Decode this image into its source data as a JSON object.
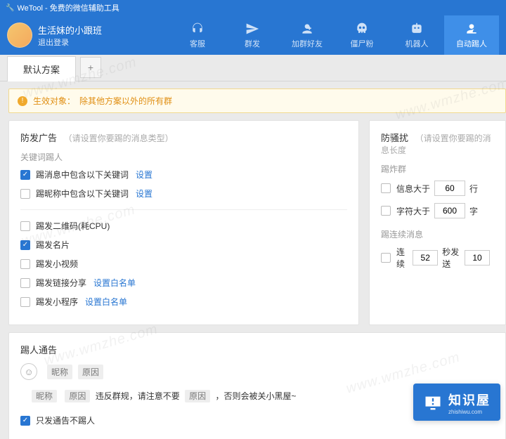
{
  "titlebar": {
    "text": "WeTool - 免费的微信辅助工具"
  },
  "user": {
    "name": "生活妹的小跟班",
    "logout": "退出登录"
  },
  "nav": [
    {
      "key": "cs",
      "label": "客服"
    },
    {
      "key": "mass",
      "label": "群发"
    },
    {
      "key": "add",
      "label": "加群好友"
    },
    {
      "key": "zombie",
      "label": "僵尸粉"
    },
    {
      "key": "robot",
      "label": "机器人"
    },
    {
      "key": "kick",
      "label": "自动踢人",
      "active": true
    }
  ],
  "tabs": {
    "active": "默认方案"
  },
  "notice": {
    "label": "生效对象：",
    "text": "除其他方案以外的所有群"
  },
  "antiAd": {
    "title": "防发广告",
    "hint": "（请设置你要踢的消息类型）",
    "keywordTitle": "关键词踢人",
    "items": {
      "msgKeyword": {
        "label": "踢消息中包含以下关键词",
        "link": "设置",
        "checked": true
      },
      "nickKeyword": {
        "label": "踢昵称中包含以下关键词",
        "link": "设置",
        "checked": false
      },
      "qr": {
        "label": "踢发二维码(耗CPU)",
        "checked": false
      },
      "card": {
        "label": "踢发名片",
        "checked": true
      },
      "video": {
        "label": "踢发小视频",
        "checked": false
      },
      "linkShare": {
        "label": "踢发链接分享",
        "link": "设置白名单",
        "checked": false
      },
      "miniProgram": {
        "label": "踢发小程序",
        "link": "设置白名单",
        "checked": false
      }
    }
  },
  "antiHarass": {
    "title": "防骚扰",
    "hint": "（请设置你要踢的消息长度",
    "bombTitle": "踢炸群",
    "msgGt": {
      "label": "信息大于",
      "value": "60",
      "unit": "行",
      "checked": false
    },
    "charGt": {
      "label": "字符大于",
      "value": "600",
      "unit": "字",
      "checked": false
    },
    "continuousTitle": "踢连续消息",
    "cont": {
      "label": "连续",
      "value": "52",
      "mid": "秒发送",
      "value2": "10",
      "checked": false
    }
  },
  "announce": {
    "title": "踢人通告",
    "chips": {
      "nick": "昵称",
      "reason": "原因"
    },
    "line": {
      "pre": "违反群规，请注意不要",
      "post": "，否则会被关小黑屋~"
    },
    "onlyNotice": {
      "label": "只发通告不踢人",
      "checked": true
    }
  },
  "badge": {
    "big": "知识屋",
    "small": "zhishiwu.com"
  },
  "watermark": "www.wmzhe.com"
}
